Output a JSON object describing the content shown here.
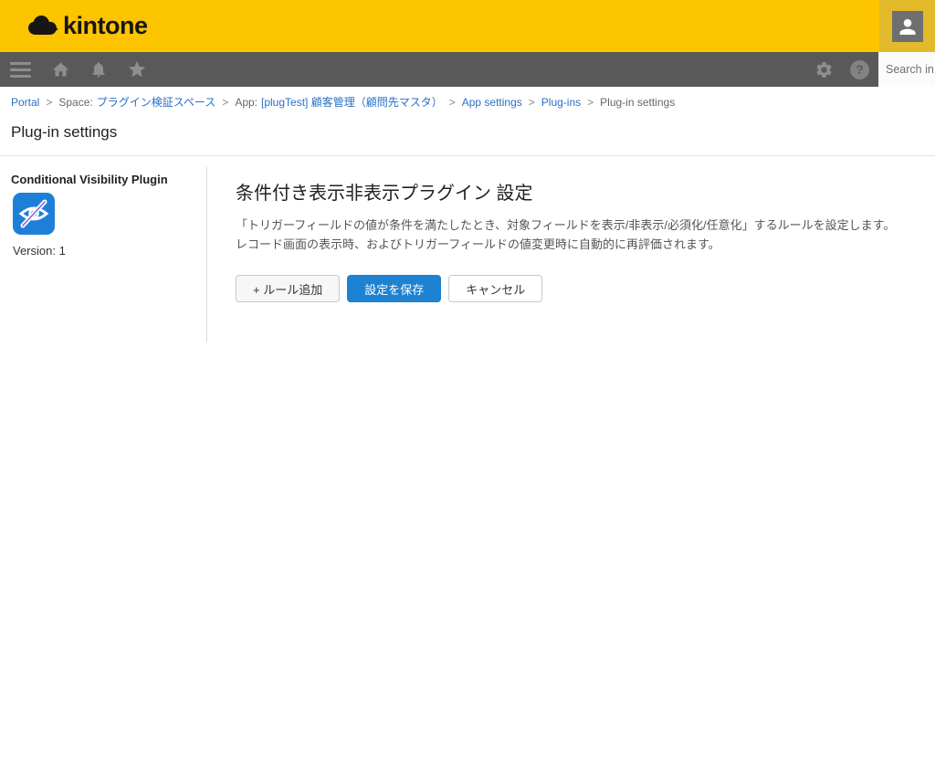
{
  "colors": {
    "header_yellow": "#fdc400",
    "avatar_area_yellow": "#e2ba2c",
    "toolbar_gray": "#595959",
    "breadcrumb_link_blue": "#2970c8",
    "save_button_blue": "#1e82d2",
    "plugin_icon_blue": "#1e7fd9"
  },
  "header": {
    "brand": "kintone"
  },
  "toolbar": {
    "icons": [
      "hamburger-menu-icon",
      "home-icon",
      "bell-icon",
      "star-icon",
      "gear-icon",
      "help-icon",
      "user-avatar-icon"
    ],
    "help_glyph": "?",
    "search_placeholder": "Search in"
  },
  "breadcrumb": {
    "separator": ">",
    "items": [
      {
        "prefix": "",
        "label": "Portal"
      },
      {
        "prefix": "Space:",
        "label": "プラグイン検証スペース"
      },
      {
        "prefix": "App:",
        "label": "[plugTest] 顧客管理（顧問先マスタ）"
      },
      {
        "prefix": "",
        "label": "App settings"
      },
      {
        "prefix": "",
        "label": "Plug-ins"
      },
      {
        "prefix": "",
        "label": "Plug-in settings"
      }
    ]
  },
  "page": {
    "title": "Plug-in settings"
  },
  "sidebar": {
    "plugin_name": "Conditional Visibility Plugin",
    "plugin_icon": "eye-off-icon",
    "version": "Version: 1"
  },
  "main": {
    "heading": "条件付き表示非表示プラグイン 設定",
    "description": [
      "「トリガーフィールドの値が条件を満たしたとき、対象フィールドを表示/非表示/必須化/任意化」するルールを設定します。",
      "レコード画面の表示時、およびトリガーフィールドの値変更時に自動的に再評価されます。"
    ],
    "buttons": {
      "add_rule": "+ ルール追加",
      "save": "設定を保存",
      "cancel": "キャンセル"
    }
  }
}
